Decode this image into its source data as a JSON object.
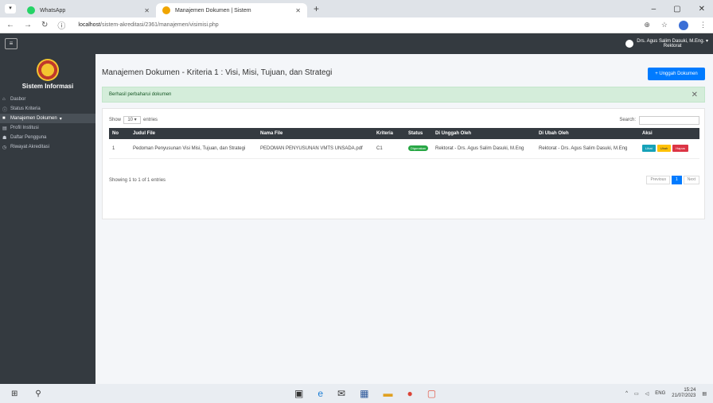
{
  "browser": {
    "tabs": [
      {
        "label": "WhatsApp",
        "icon": "whatsapp-icon",
        "active": false
      },
      {
        "label": "Manajemen Dokumen | Sistem",
        "icon": "site-icon",
        "active": true
      }
    ],
    "url_host": "localhost",
    "url_path": "/sistem-akreditasi/2361/manajemen/visimisi.php"
  },
  "navbar": {
    "user_name": "Drs. Agus Salim Dasuki, M.Eng.",
    "user_role": "Rektorat"
  },
  "sidebar": {
    "brand": "Sistem Informasi",
    "items": [
      {
        "label": "Dasbor",
        "icon": "home-icon"
      },
      {
        "label": "Status Kriteria",
        "icon": "info-icon"
      },
      {
        "label": "Manajemen Dokumen",
        "icon": "folder-icon",
        "active": true
      },
      {
        "label": "Profil Institusi",
        "icon": "building-icon"
      },
      {
        "label": "Daftar Pengguna",
        "icon": "users-icon"
      },
      {
        "label": "Riwayat Akreditasi",
        "icon": "history-icon"
      }
    ]
  },
  "main": {
    "title": "Manajemen Dokumen - Kriteria 1 : Visi, Misi, Tujuan, dan Strategi",
    "upload_button": "+ Unggah Dokumen",
    "alert": "Berhasil perbaharui dokumen",
    "show_label": "Show",
    "show_value": "10",
    "entries_label": "entries",
    "search_label": "Search:",
    "columns": [
      "No",
      "Judul File",
      "Nama File",
      "Kriteria",
      "Status",
      "Di Unggah Oleh",
      "Di Ubah Oleh",
      "Aksi"
    ],
    "rows": [
      {
        "no": "1",
        "judul": "Pedoman Penyusunan Visi Misi, Tujuan, dan Strategi",
        "nama_file": "PEDOMAN PENYUSUNAN VMTS UNSADA.pdf",
        "kriteria": "C1",
        "status": "Digunakan",
        "diunggah": "Rektorat - Drs. Agus Salim Dasuki, M.Eng",
        "diubah": "Rektorat - Drs. Agus Salim Dasuki, M.Eng"
      }
    ],
    "action_labels": {
      "lihat": "Lihat",
      "ubah": "Ubah",
      "hapus": "Hapus"
    },
    "info": "Showing 1 to 1 of 1 entries",
    "pager": {
      "prev": "Previous",
      "page": "1",
      "next": "Next"
    }
  },
  "taskbar": {
    "lang": "ENG",
    "time": "15:24",
    "date": "21/07/2023"
  },
  "colors": {
    "primary": "#007bff",
    "sidebar": "#343a40",
    "success": "#28a745",
    "alert_bg": "#d4edda"
  }
}
